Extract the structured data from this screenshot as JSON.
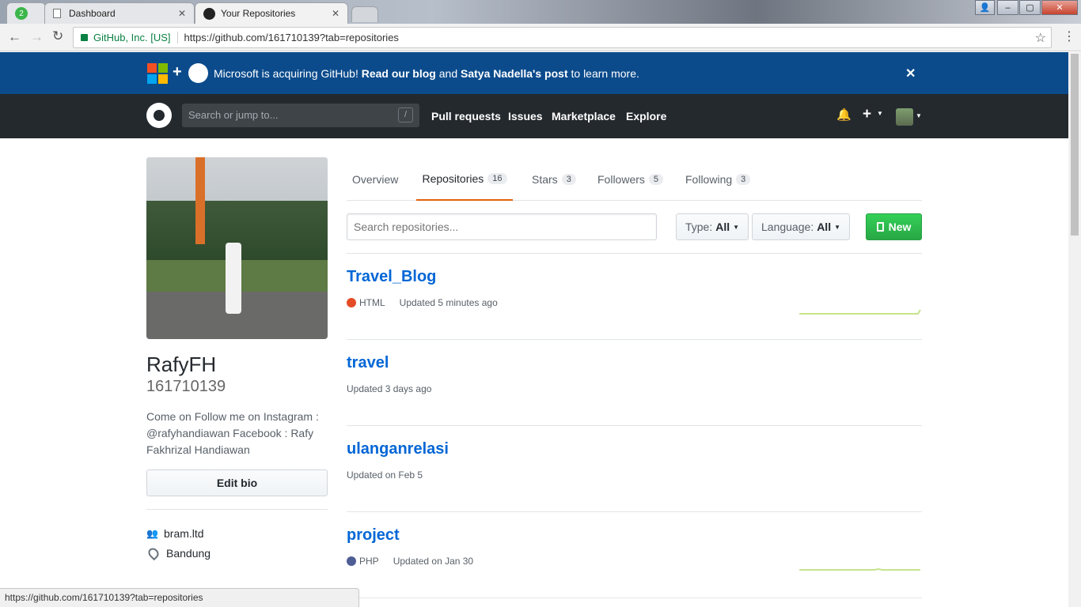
{
  "browser": {
    "tabs": [
      {
        "label": "2",
        "badge": true
      },
      {
        "label": "Dashboard"
      },
      {
        "label": "Your Repositories"
      }
    ],
    "site_identity": "GitHub, Inc. [US]",
    "url": "https://github.com/161710139?tab=repositories",
    "status_url": "https://github.com/161710139?tab=repositories"
  },
  "banner": {
    "text_a": "Microsoft is acquiring GitHub!",
    "link_blog": "Read our blog",
    "text_b": "and",
    "link_post": "Satya Nadella's post",
    "text_c": "to learn more."
  },
  "header": {
    "search_placeholder": "Search or jump to...",
    "search_key": "/",
    "links": [
      "Pull requests",
      "Issues",
      "Marketplace",
      "Explore"
    ]
  },
  "profile": {
    "name": "RafyFH",
    "username": "161710139",
    "bio_lines": [
      "Come on Follow me on Instagram :",
      "@rafyhandiawan Facebook : Rafy",
      "Fakhrizal Handiawan"
    ],
    "edit_bio_label": "Edit bio",
    "organization": "bram.ltd",
    "location": "Bandung"
  },
  "nav": {
    "overview": "Overview",
    "repositories": "Repositories",
    "repositories_count": "16",
    "stars": "Stars",
    "stars_count": "3",
    "followers": "Followers",
    "followers_count": "5",
    "following": "Following",
    "following_count": "3"
  },
  "filters": {
    "search_placeholder": "Search repositories...",
    "type_label": "Type:",
    "type_value": "All",
    "language_label": "Language:",
    "language_value": "All",
    "new_label": "New"
  },
  "repos": [
    {
      "name": "Travel_Blog",
      "language": "HTML",
      "language_color": "#e34c26",
      "updated": "Updated 5 minutes ago"
    },
    {
      "name": "travel",
      "language": "",
      "updated": "Updated 3 days ago"
    },
    {
      "name": "ulanganrelasi",
      "language": "",
      "updated": "Updated on Feb 5"
    },
    {
      "name": "project",
      "language": "PHP",
      "language_color": "#4F5D95",
      "updated": "Updated on Jan 30"
    }
  ],
  "colors": {
    "banner_bg": "#0b4b8c",
    "header_bg": "#24292e",
    "link_blue": "#0366d6",
    "new_button_green": "#28a745",
    "active_tab_underline": "#e36209"
  }
}
